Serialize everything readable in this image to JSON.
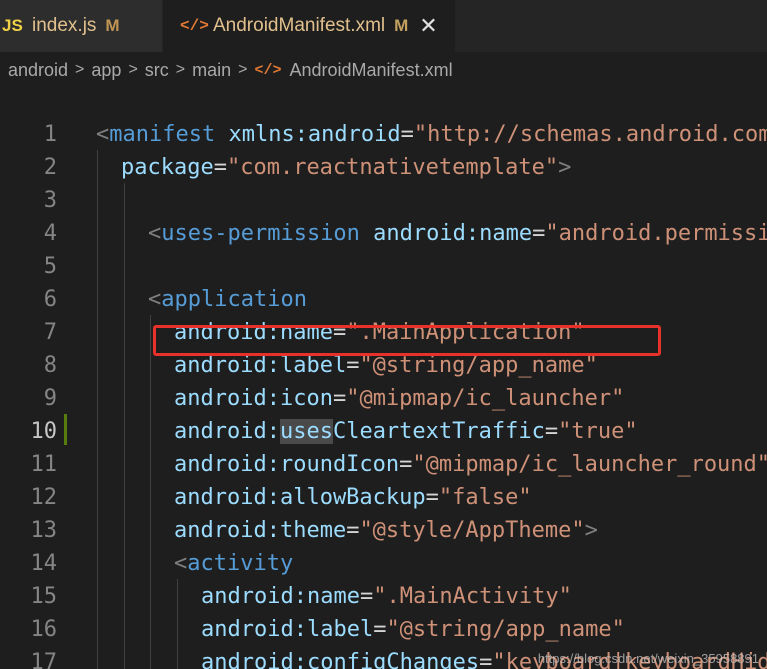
{
  "tabs": [
    {
      "icon": "JS",
      "label": "index.js",
      "status": "M",
      "active": false
    },
    {
      "icon": "</>",
      "label": "AndroidManifest.xml",
      "status": "M",
      "active": true,
      "close": "✕"
    }
  ],
  "breadcrumb": {
    "items": [
      "android",
      "app",
      "src",
      "main",
      "AndroidManifest.xml"
    ],
    "separator": ">",
    "file_icon": "</>"
  },
  "editor": {
    "current_line": 10,
    "lines": [
      {
        "n": "1",
        "tokens": [
          {
            "t": "<",
            "c": "punct"
          },
          {
            "t": "manifest",
            "c": "tag"
          },
          {
            "t": " xmlns:android",
            "c": "attr"
          },
          {
            "t": "=",
            "c": "eq"
          },
          {
            "t": "\"http://schemas.android.com",
            "c": "str"
          }
        ]
      },
      {
        "n": "2",
        "tokens": [
          {
            "t": "package",
            "c": "attr"
          },
          {
            "t": "=",
            "c": "eq"
          },
          {
            "t": "\"com.reactnativetemplate\"",
            "c": "str"
          },
          {
            "t": ">",
            "c": "punct"
          }
        ]
      },
      {
        "n": "3",
        "tokens": []
      },
      {
        "n": "4",
        "tokens": [
          {
            "t": "<",
            "c": "punct"
          },
          {
            "t": "uses-permission",
            "c": "tag"
          },
          {
            "t": " android:name",
            "c": "attr"
          },
          {
            "t": "=",
            "c": "eq"
          },
          {
            "t": "\"android.permissi",
            "c": "str"
          }
        ]
      },
      {
        "n": "5",
        "tokens": []
      },
      {
        "n": "6",
        "tokens": [
          {
            "t": "<",
            "c": "punct"
          },
          {
            "t": "application",
            "c": "tag"
          }
        ]
      },
      {
        "n": "7",
        "tokens": [
          {
            "t": "android:name",
            "c": "attr"
          },
          {
            "t": "=",
            "c": "eq"
          },
          {
            "t": "\".MainApplication\"",
            "c": "str"
          }
        ]
      },
      {
        "n": "8",
        "tokens": [
          {
            "t": "android:label",
            "c": "attr"
          },
          {
            "t": "=",
            "c": "eq"
          },
          {
            "t": "\"@string/app_name\"",
            "c": "str"
          }
        ]
      },
      {
        "n": "9",
        "tokens": [
          {
            "t": "android:icon",
            "c": "attr"
          },
          {
            "t": "=",
            "c": "eq"
          },
          {
            "t": "\"@mipmap/ic_launcher\"",
            "c": "str"
          }
        ]
      },
      {
        "n": "10",
        "tokens": [
          {
            "t": "android:",
            "c": "attr"
          },
          {
            "t": "uses",
            "c": "attr hl"
          },
          {
            "t": "CleartextTraffic",
            "c": "attr"
          },
          {
            "t": "=",
            "c": "eq"
          },
          {
            "t": "\"true\"",
            "c": "str"
          }
        ]
      },
      {
        "n": "11",
        "tokens": [
          {
            "t": "android:roundIcon",
            "c": "attr"
          },
          {
            "t": "=",
            "c": "eq"
          },
          {
            "t": "\"@mipmap/ic_launcher_round\"",
            "c": "str"
          }
        ]
      },
      {
        "n": "12",
        "tokens": [
          {
            "t": "android:allowBackup",
            "c": "attr"
          },
          {
            "t": "=",
            "c": "eq"
          },
          {
            "t": "\"false\"",
            "c": "str"
          }
        ]
      },
      {
        "n": "13",
        "tokens": [
          {
            "t": "android:theme",
            "c": "attr"
          },
          {
            "t": "=",
            "c": "eq"
          },
          {
            "t": "\"@style/AppTheme\"",
            "c": "str"
          },
          {
            "t": ">",
            "c": "punct"
          }
        ]
      },
      {
        "n": "14",
        "tokens": [
          {
            "t": "<",
            "c": "punct"
          },
          {
            "t": "activity",
            "c": "tag"
          }
        ]
      },
      {
        "n": "15",
        "tokens": [
          {
            "t": "android:name",
            "c": "attr"
          },
          {
            "t": "=",
            "c": "eq"
          },
          {
            "t": "\".MainActivity\"",
            "c": "str"
          }
        ]
      },
      {
        "n": "16",
        "tokens": [
          {
            "t": "android:label",
            "c": "attr"
          },
          {
            "t": "=",
            "c": "eq"
          },
          {
            "t": "\"@string/app_name\"",
            "c": "str"
          }
        ]
      },
      {
        "n": "17",
        "tokens": [
          {
            "t": "android:configChanges",
            "c": "attr"
          },
          {
            "t": "=",
            "c": "eq"
          },
          {
            "t": "\"keyboard|keyboardHid",
            "c": "str"
          }
        ]
      }
    ]
  },
  "watermark": "https://blog.csdn.net/weixin_35958891",
  "colors": {
    "editor_bg": "#1e1e1e",
    "tag": "#569cd6",
    "attribute": "#9cdcfe",
    "string": "#ce9178",
    "annotation_box": "#e8312a",
    "modified_badge": "#c09553"
  }
}
